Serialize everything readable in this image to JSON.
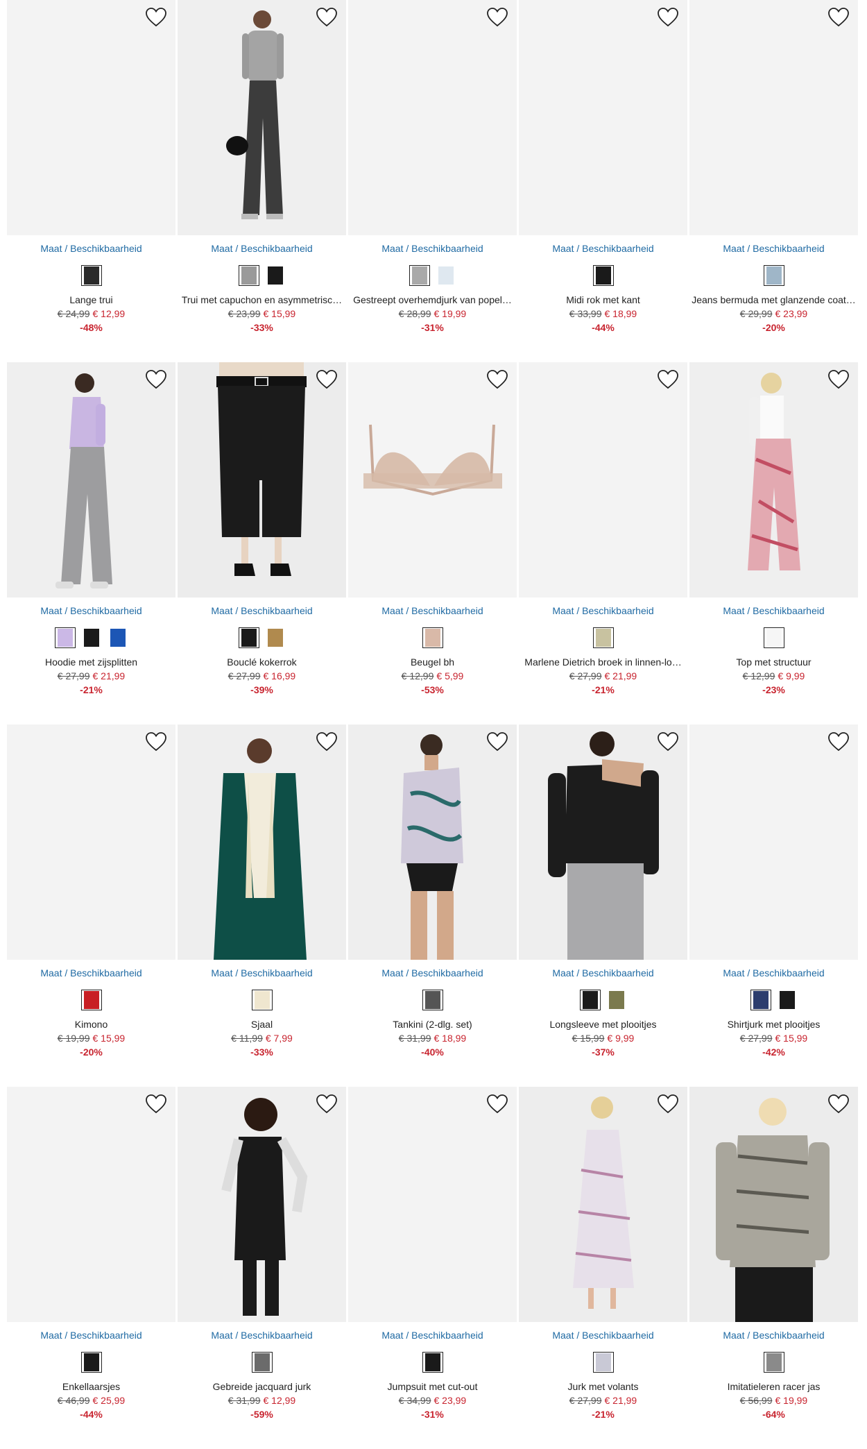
{
  "size_link_label": "Maat / Beschikbaarheid",
  "colors": {
    "price_red": "#c8242f",
    "link_blue": "#1f6aa3",
    "tile_bg": "#f2f2f2"
  },
  "products": [
    {
      "name": "Lange trui",
      "old_price": "€ 24,99",
      "new_price": "€ 12,99",
      "discount": "-48%",
      "swatches": [
        "#2a2a2a"
      ],
      "image": "empty"
    },
    {
      "name": "Trui met capuchon en asymmetrisc…",
      "old_price": "€ 23,99",
      "new_price": "€ 15,99",
      "discount": "-33%",
      "swatches": [
        "#9a9a9a",
        "#1a1a1a"
      ],
      "image": "woman-grey-hoodie-jeans"
    },
    {
      "name": "Gestreept overhemdjurk van popel…",
      "old_price": "€ 28,99",
      "new_price": "€ 19,99",
      "discount": "-31%",
      "swatches": [
        "#a9a9a9",
        "#dfe8f0"
      ],
      "image": "empty"
    },
    {
      "name": "Midi rok met kant",
      "old_price": "€ 33,99",
      "new_price": "€ 18,99",
      "discount": "-44%",
      "swatches": [
        "#1a1a1a"
      ],
      "image": "empty"
    },
    {
      "name": "Jeans bermuda met glanzende coat…",
      "old_price": "€ 29,99",
      "new_price": "€ 23,99",
      "discount": "-20%",
      "swatches": [
        "#9fb6c8"
      ],
      "image": "empty"
    },
    {
      "name": "Hoodie met zijsplitten",
      "old_price": "€ 27,99",
      "new_price": "€ 21,99",
      "discount": "-21%",
      "swatches": [
        "#cbb8e6",
        "#1a1a1a",
        "#1c56b5"
      ],
      "image": "woman-lilac-hoodie"
    },
    {
      "name": "Bouclé kokerrok",
      "old_price": "€ 27,99",
      "new_price": "€ 16,99",
      "discount": "-39%",
      "swatches": [
        "#1a1a1a",
        "#b08a4e"
      ],
      "image": "black-skirt"
    },
    {
      "name": "Beugel bh",
      "old_price": "€ 12,99",
      "new_price": "€ 5,99",
      "discount": "-53%",
      "swatches": [
        "#d9b9a8"
      ],
      "image": "bra"
    },
    {
      "name": "Marlene Dietrich broek in linnen-lo…",
      "old_price": "€ 27,99",
      "new_price": "€ 21,99",
      "discount": "-21%",
      "swatches": [
        "#c8c2a0"
      ],
      "image": "empty"
    },
    {
      "name": "Top met structuur",
      "old_price": "€ 12,99",
      "new_price": "€ 9,99",
      "discount": "-23%",
      "swatches": [
        "#f6f6f6"
      ],
      "image": "woman-floral-pants"
    },
    {
      "name": "Kimono",
      "old_price": "€ 19,99",
      "new_price": "€ 15,99",
      "discount": "-20%",
      "swatches": [
        "#c81e23"
      ],
      "image": "empty"
    },
    {
      "name": "Sjaal",
      "old_price": "€ 11,99",
      "new_price": "€ 7,99",
      "discount": "-33%",
      "swatches": [
        "#efe6cf"
      ],
      "image": "woman-green-blazer"
    },
    {
      "name": "Tankini (2-dlg. set)",
      "old_price": "€ 31,99",
      "new_price": "€ 18,99",
      "discount": "-40%",
      "swatches": [
        "#555555"
      ],
      "image": "woman-tankini"
    },
    {
      "name": "Longsleeve met plooitjes",
      "old_price": "€ 15,99",
      "new_price": "€ 9,99",
      "discount": "-37%",
      "swatches": [
        "#1a1a1a",
        "#7b7a4e"
      ],
      "image": "woman-black-top-back"
    },
    {
      "name": "Shirtjurk met plooitjes",
      "old_price": "€ 27,99",
      "new_price": "€ 15,99",
      "discount": "-42%",
      "swatches": [
        "#2c3d6e",
        "#1a1a1a"
      ],
      "image": "empty"
    },
    {
      "name": "Enkellaarsjes",
      "old_price": "€ 46,99",
      "new_price": "€ 25,99",
      "discount": "-44%",
      "swatches": [
        "#1a1a1a"
      ],
      "image": "empty"
    },
    {
      "name": "Gebreide jacquard jurk",
      "old_price": "€ 31,99",
      "new_price": "€ 12,99",
      "discount": "-59%",
      "swatches": [
        "#6b6b6b"
      ],
      "image": "woman-jacquard-dress"
    },
    {
      "name": "Jumpsuit met cut-out",
      "old_price": "€ 34,99",
      "new_price": "€ 23,99",
      "discount": "-31%",
      "swatches": [
        "#1a1a1a"
      ],
      "image": "empty"
    },
    {
      "name": "Jurk met volants",
      "old_price": "€ 27,99",
      "new_price": "€ 21,99",
      "discount": "-21%",
      "swatches": [
        "#c9c9d6"
      ],
      "image": "woman-floral-dress"
    },
    {
      "name": "Imitatieleren racer jas",
      "old_price": "€ 56,99",
      "new_price": "€ 19,99",
      "discount": "-64%",
      "swatches": [
        "#8a8a8a"
      ],
      "image": "woman-snake-jacket"
    }
  ]
}
